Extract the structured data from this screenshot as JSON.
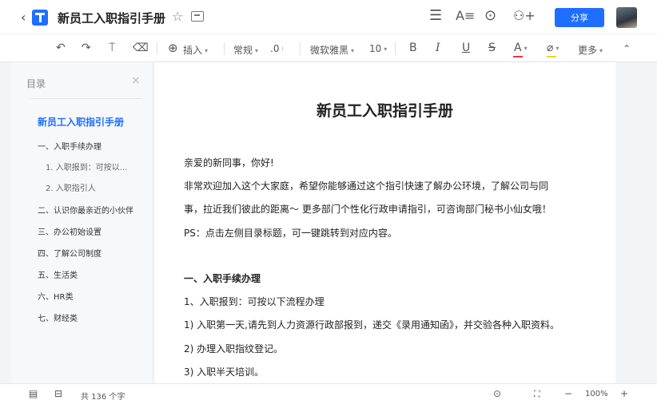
{
  "titlebar": {
    "back_icon": "chevron-left-icon",
    "doc_title": "新员工入职指引手册",
    "share_label": "分享"
  },
  "toolbar": {
    "insert_label": "插入",
    "style_label": "常规",
    "spacing_label": ".0",
    "font_label": "微软雅黑",
    "size_label": "10",
    "bold_label": "B",
    "italic_label": "I",
    "underline_label": "U",
    "strike_label": "S",
    "font_color_label": "A",
    "more_label": "更多"
  },
  "sidebar": {
    "heading": "目录",
    "doc_link": "新员工入职指引手册",
    "items": [
      {
        "label": "一、入职手续办理"
      },
      {
        "label": "1. 入职报到：可按以..."
      },
      {
        "label": "2. 入职指引人"
      },
      {
        "label": "二、认识你最亲近的小伙伴"
      },
      {
        "label": "三、办公初始设置"
      },
      {
        "label": "四、了解公司制度"
      },
      {
        "label": "五、生活类"
      },
      {
        "label": "六、HR类"
      },
      {
        "label": "七、财经类"
      }
    ]
  },
  "document": {
    "title": "新员工入职指引手册",
    "lines": [
      "亲爱的新同事，你好!",
      "非常欢迎加入这个大家庭，希望你能够通过这个指引快速了解办公环境，了解公司与同",
      "事，拉近我们彼此的距离～ 更多部门个性化行政申请指引，可咨询部门秘书小仙女哦！",
      "PS：点击左侧目录标题，可一键跳转到对应内容。",
      "一、入职手续办理",
      "1、入职报到：可按以下流程办理",
      "1) 入职第一天,请先到人力资源行政部报到，递交《录用通知函》，并交验各种入职资料。",
      "2) 办理入职指纹登记。",
      "3) 入职半天培训。"
    ]
  },
  "statusbar": {
    "word_count": "共 136 个字",
    "zoom_level": "100%",
    "zoom_out": "−",
    "zoom_in": "+"
  },
  "colors": {
    "accent": "#1e6fff",
    "font_color_bar": "#e23c39",
    "highlight_bar": "#f5d80a"
  }
}
